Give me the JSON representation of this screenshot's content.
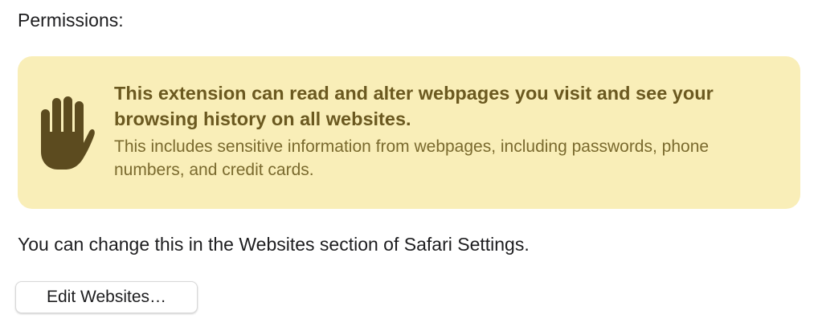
{
  "permissions": {
    "section_label": "Permissions:",
    "warning": {
      "icon": "hand-raised-icon",
      "icon_color": "#5c4b1f",
      "background_color": "#f9eeb8",
      "title": "This extension can read and alter webpages you visit and see your browsing history on all websites.",
      "detail": "This includes sensitive information from webpages, including passwords, phone numbers, and credit cards."
    },
    "info_text": "You can change this in the Websites section of Safari Settings.",
    "edit_button_label": "Edit Websites…"
  }
}
